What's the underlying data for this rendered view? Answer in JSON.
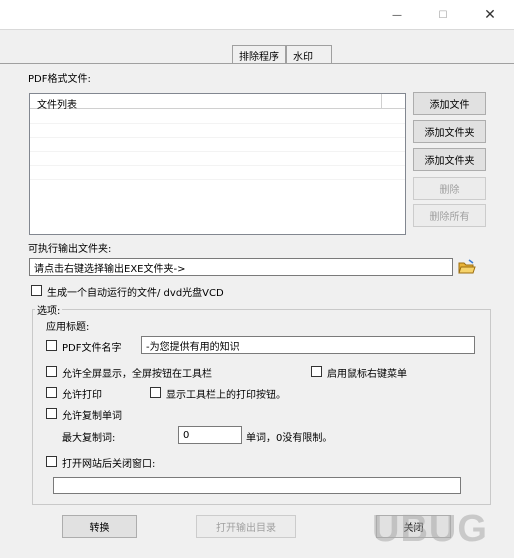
{
  "window": {
    "minimize_glyph": "—",
    "maximize_glyph": "☐",
    "close_glyph": "✕"
  },
  "tabs": [
    "排除程序",
    "水印"
  ],
  "pdf_section": {
    "label": "PDF格式文件:",
    "column_header": "文件列表"
  },
  "side_buttons": {
    "add_file": "添加文件",
    "add_folder": "添加文件夹",
    "add_folder2": "添加文件夹",
    "delete": "删除",
    "delete_all": "删除所有"
  },
  "output": {
    "label": "可执行输出文件夹:",
    "value": "请点击右键选择输出EXE文件夹->",
    "folder_icon": "folder-icon"
  },
  "autorun": {
    "label": "生成一个自动运行的文件/ dvd光盘VCD",
    "checked": false
  },
  "options": {
    "legend": "选项:",
    "app_title_label": "应用标题:",
    "pdf_name_label": "PDF文件名字",
    "pdf_name_value": "-为您提供有用的知识",
    "fullscreen_label": "允许全屏显示，全屏按钮在工具栏",
    "right_click_label": "启用鼠标右键菜单",
    "allow_print_label": "允许打印",
    "show_print_label": "显示工具栏上的打印按钮。",
    "allow_copy_label": "允许复制单词",
    "max_copy_label": "最大复制词:",
    "max_copy_value": "0",
    "max_copy_suffix": "单词，0没有限制。",
    "close_window_label": "打开网站后关闭窗口:",
    "url_value": ""
  },
  "bottom": {
    "convert": "转换",
    "open_output": "打开输出目录",
    "close": "关闭"
  },
  "watermark": "UBUG"
}
